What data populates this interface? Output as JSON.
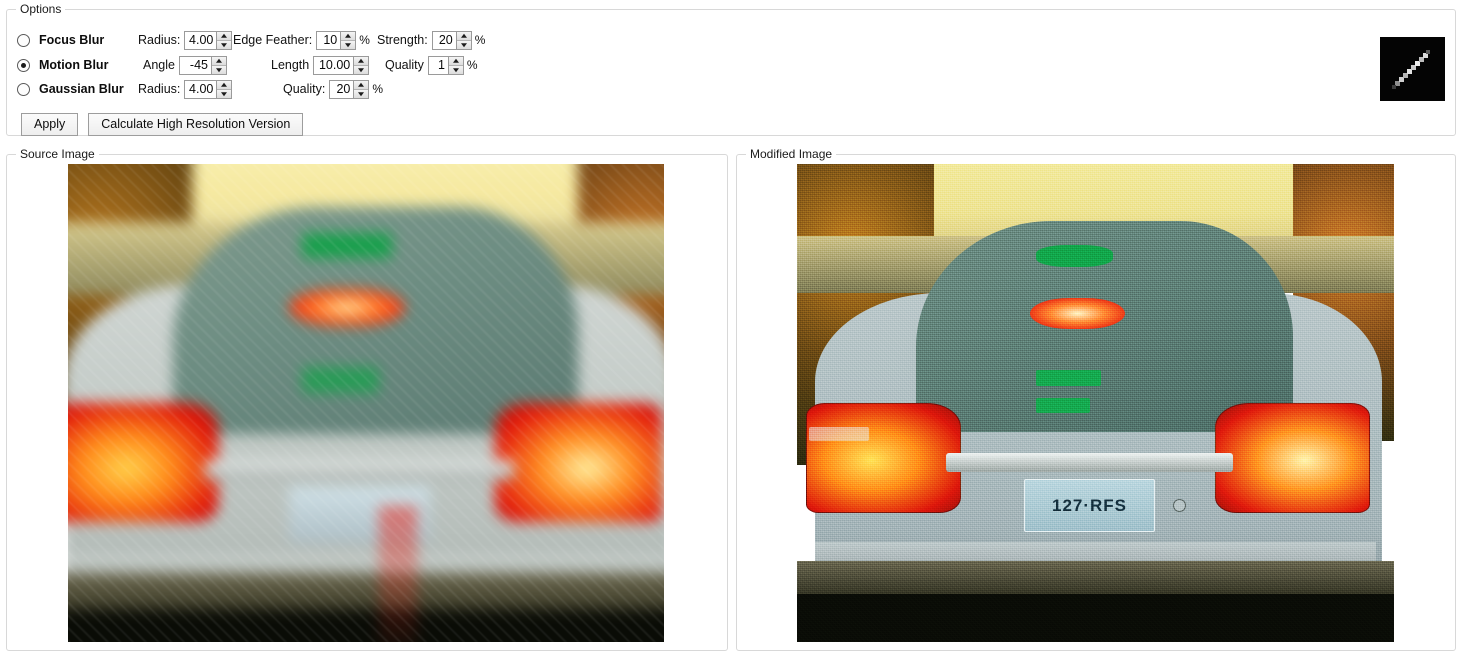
{
  "options": {
    "legend": "Options",
    "modes": [
      {
        "id": "focus-blur",
        "label": "Focus Blur",
        "selected": false,
        "fields": [
          {
            "caption": "Radius:",
            "value": "4.00",
            "suffix": ""
          },
          {
            "caption": "Edge Feather:",
            "value": "10",
            "suffix": "%"
          },
          {
            "caption": "Strength:",
            "value": "20",
            "suffix": "%"
          }
        ]
      },
      {
        "id": "motion-blur",
        "label": "Motion Blur",
        "selected": true,
        "fields": [
          {
            "caption": "Angle",
            "value": "-45",
            "suffix": ""
          },
          {
            "caption": "Length",
            "value": "10.00",
            "suffix": ""
          },
          {
            "caption": "Quality",
            "value": "1",
            "suffix": "%"
          }
        ]
      },
      {
        "id": "gaussian-blur",
        "label": "Gaussian Blur",
        "selected": false,
        "fields": [
          {
            "caption": "Radius:",
            "value": "4.00",
            "suffix": ""
          },
          {
            "caption": "Quality:",
            "value": "20",
            "suffix": "%"
          }
        ]
      }
    ],
    "buttons": {
      "apply": "Apply",
      "calculate_high_res": "Calculate High Resolution Version"
    },
    "kernel_preview": {
      "name": "motion-blur-kernel-preview",
      "background": "#040404",
      "streak_color": "#e8e8e8",
      "angle_degrees": -45,
      "length": 10
    }
  },
  "panels": {
    "source": {
      "legend": "Source Image",
      "description": "motion-blurred photo of car rear with tail lights",
      "plate_text": ""
    },
    "modified": {
      "legend": "Modified Image",
      "description": "deconvolved sharpened photo of car rear with visible noise",
      "plate_text": "127·RFS"
    }
  },
  "colors": {
    "sky": "#f2e9a8",
    "car_body": "#c9cfc9",
    "window_glass": "#7d968c",
    "taillight_red": "#e01b10",
    "taillight_amber": "#ffb300",
    "brake_light": "#ff4a2a",
    "green_sticker": "#15a24a",
    "plate_bg": "#a9cfd8",
    "groupbox_border": "#d8d8d8",
    "spin_border": "#9a9a9a",
    "button_border": "#9d9d9d"
  }
}
